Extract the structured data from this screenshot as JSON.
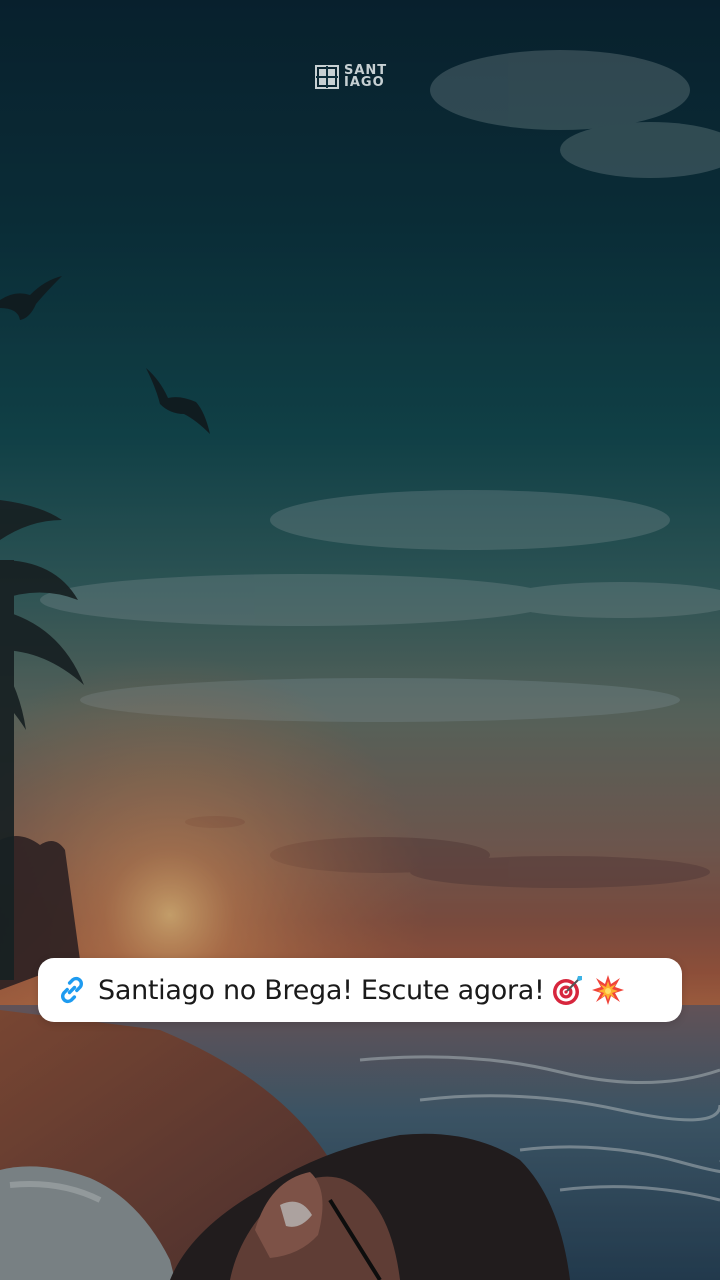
{
  "brand": {
    "logo_line1": "SANT",
    "logo_line2": "IAGO"
  },
  "sticker": {
    "text": "Santiago no Brega! Escute agora!",
    "icon": "link-icon",
    "emojis": [
      "direct-hit-target-emoji",
      "collision-emoji"
    ],
    "accent_color": "#1e9bf0"
  },
  "background": {
    "scene": "sunset beach with palm trees, seagulls and a man lying in the foreground"
  }
}
